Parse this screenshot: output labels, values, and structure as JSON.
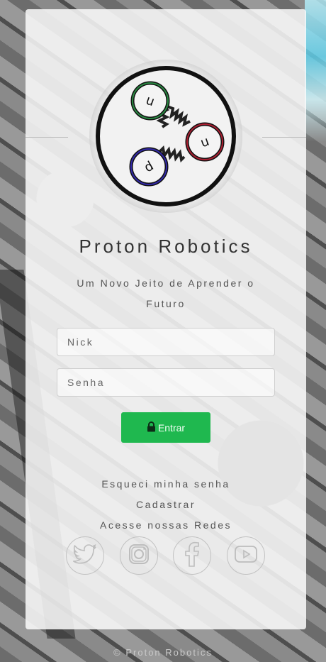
{
  "brand": {
    "title": "Proton Robotics",
    "subtitle": "Um Novo Jeito de Aprender o Futuro"
  },
  "logo": {
    "particles": [
      {
        "label": "u",
        "color": "#2fa84f"
      },
      {
        "label": "u",
        "color": "#d2233a"
      },
      {
        "label": "d",
        "color": "#3b2fcf"
      }
    ]
  },
  "form": {
    "nick_placeholder": "Nick",
    "password_placeholder": "Senha",
    "submit_label": "Entrar",
    "submit_icon": "lock-icon",
    "accent": "#1fb84f"
  },
  "links": {
    "forgot_password": "Esqueci minha senha",
    "register": "Cadastrar",
    "social_heading": "Acesse nossas Redes"
  },
  "social": [
    {
      "name": "twitter",
      "icon": "twitter-icon"
    },
    {
      "name": "instagram",
      "icon": "instagram-icon"
    },
    {
      "name": "facebook",
      "icon": "facebook-icon"
    },
    {
      "name": "youtube",
      "icon": "youtube-icon"
    }
  ],
  "footer": {
    "copyright": "© Proton Robotics"
  }
}
